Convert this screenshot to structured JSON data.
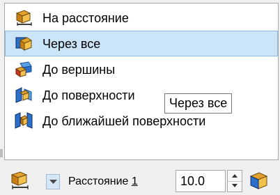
{
  "menu": {
    "items": [
      {
        "label": "На расстояние",
        "icon": "extrude-distance-icon"
      },
      {
        "label": "Через все",
        "icon": "extrude-through-all-icon",
        "highlighted": true
      },
      {
        "label": "До вершины",
        "icon": "extrude-to-vertex-icon"
      },
      {
        "label": "До поверхности",
        "icon": "extrude-to-surface-icon"
      },
      {
        "label": "До ближайшей поверхности",
        "icon": "extrude-to-nearest-surface-icon"
      }
    ]
  },
  "tooltip": {
    "text": "Через все"
  },
  "toolbar": {
    "param_label_prefix": "Расстояние ",
    "param_label_index": "1",
    "value": "10.0"
  },
  "colors": {
    "highlight": "#cce4f7",
    "icon_blue": "#2a6fc9",
    "icon_orange": "#e3a02a"
  }
}
